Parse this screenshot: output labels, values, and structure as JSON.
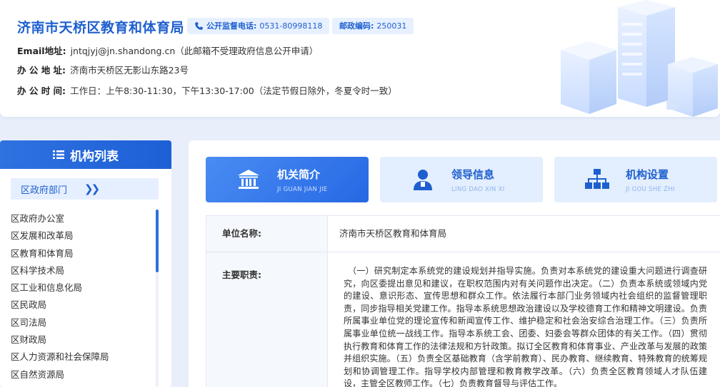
{
  "header": {
    "title": "济南市天桥区教育和体育局",
    "phone_label": "公开监督电话:",
    "phone_value": "0531-80998118",
    "postal_label": "邮政编码:",
    "postal_value": "250031",
    "email_label": "Email地址:",
    "email_value": "jntqjyj@jn.shandong.cn（此邮箱不受理政府信息公开申请）",
    "address_label": "办 公 地 址:",
    "address_value": "济南市天桥区无影山东路23号",
    "hours_label": "办 公 时 间:",
    "hours_value": "工作日：上午8:30-11:30，下午13:30-17:00（法定节假日除外，冬夏令时一致）"
  },
  "sidebar": {
    "title": "机构列表",
    "category_tab": "区政府部门",
    "items": [
      "区政府办公室",
      "区发展和改革局",
      "区教育和体育局",
      "区科学技术局",
      "区工业和信息化局",
      "区民政局",
      "区司法局",
      "区财政局",
      "区人力资源和社会保障局",
      "区自然资源局"
    ]
  },
  "tabs": {
    "intro": {
      "cn": "机关简介",
      "py": "JI GUAN JIAN JIE"
    },
    "leader": {
      "cn": "领导信息",
      "py": "LING DAO XIN XI"
    },
    "org": {
      "cn": "机构设置",
      "py": "JI GOU SHE ZHI"
    }
  },
  "table": {
    "unit_label": "单位名称:",
    "unit_value": "济南市天桥区教育和体育局",
    "duty_label": "主要职责:",
    "duty_value": "（一）研究制定本系统党的建设规划并指导实施。负责对本系统党的建设重大问题进行调查研究，向区委提出意见和建议，在职权范围内对有关问题作出决定。（二）负责本系统或领域内党的建设、意识形态、宣传思想和群众工作。依法履行本部门业务领域内社会组织的监督管理职责，同步指导相关党建工作。指导本系统思想政治建设以及学校德育工作和精神文明建设。负责所属事业单位党的理论宣传和新闻宣传工作、维护稳定和社会治安综合治理工作。（三）负责所属事业单位统一战线工作。指导本系统工会、团委、妇委会等群众团体的有关工作。（四）贯彻执行教育和体育工作的法律法规和方针政策。拟订全区教育和体育事业、产业改革与发展的政策并组织实施。（五）负责全区基础教育（含学前教育）、民办教育、继续教育、特殊教育的统筹规划和协调管理工作。指导学校内部管理和教育教学改革。（六）负责全区教育领域人才队伍建设，主管全区教师工作。（七）负责教育督导与评估工作。"
  },
  "colors": {
    "brand_blue": "#1e5fcf",
    "active_tab": "#2668e3",
    "idle_tab_bg": "#e3eefe",
    "page_bg": "#e8eefa"
  }
}
